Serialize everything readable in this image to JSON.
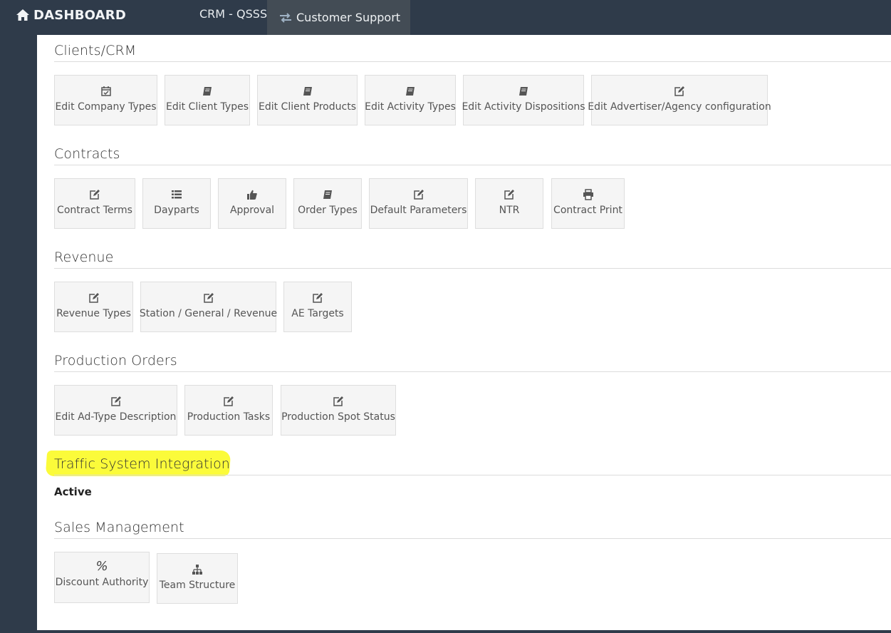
{
  "topbar": {
    "dashboard_label": "DASHBOARD",
    "crm_label": "CRM - QSSS",
    "support_label": "Customer Support"
  },
  "sections": {
    "clients": {
      "title": "Clients/CRM",
      "items": [
        {
          "label": "Edit Company Types",
          "icon": "calendar-check-icon"
        },
        {
          "label": "Edit Client Types",
          "icon": "book-icon"
        },
        {
          "label": "Edit Client Products",
          "icon": "book-icon"
        },
        {
          "label": "Edit Activity Types",
          "icon": "book-icon"
        },
        {
          "label": "Edit Activity Dispositions",
          "icon": "book-icon"
        },
        {
          "label": "Edit Advertiser/Agency configuration",
          "icon": "edit-icon"
        }
      ]
    },
    "contracts": {
      "title": "Contracts",
      "items": [
        {
          "label": "Contract Terms",
          "icon": "edit-icon"
        },
        {
          "label": "Dayparts",
          "icon": "list-icon"
        },
        {
          "label": "Approval",
          "icon": "thumbs-up-icon"
        },
        {
          "label": "Order Types",
          "icon": "book-icon"
        },
        {
          "label": "Default Parameters",
          "icon": "edit-icon"
        },
        {
          "label": "NTR",
          "icon": "edit-icon"
        },
        {
          "label": "Contract Print",
          "icon": "print-icon"
        }
      ]
    },
    "revenue": {
      "title": "Revenue",
      "items": [
        {
          "label": "Revenue Types",
          "icon": "edit-icon"
        },
        {
          "label": "Station / General / Revenue",
          "icon": "edit-icon"
        },
        {
          "label": "AE Targets",
          "icon": "edit-icon"
        }
      ]
    },
    "production": {
      "title": "Production Orders",
      "items": [
        {
          "label": "Edit Ad-Type Description",
          "icon": "edit-icon"
        },
        {
          "label": "Production Tasks",
          "icon": "edit-icon"
        },
        {
          "label": "Production Spot Status",
          "icon": "edit-icon"
        }
      ]
    },
    "traffic": {
      "title": "Traffic System Integration",
      "status": "Active"
    },
    "sales": {
      "title": "Sales Management",
      "items": [
        {
          "label": "Discount Authority",
          "icon": "percent-icon",
          "glyph": "%"
        },
        {
          "label": "Team Structure",
          "icon": "sitemap-icon"
        }
      ]
    }
  },
  "colors": {
    "sidebar": "#2f3b4a",
    "active_tab": "#434c55",
    "tile_bg": "#f5f5f5",
    "highlight": "#fbfb3a"
  }
}
